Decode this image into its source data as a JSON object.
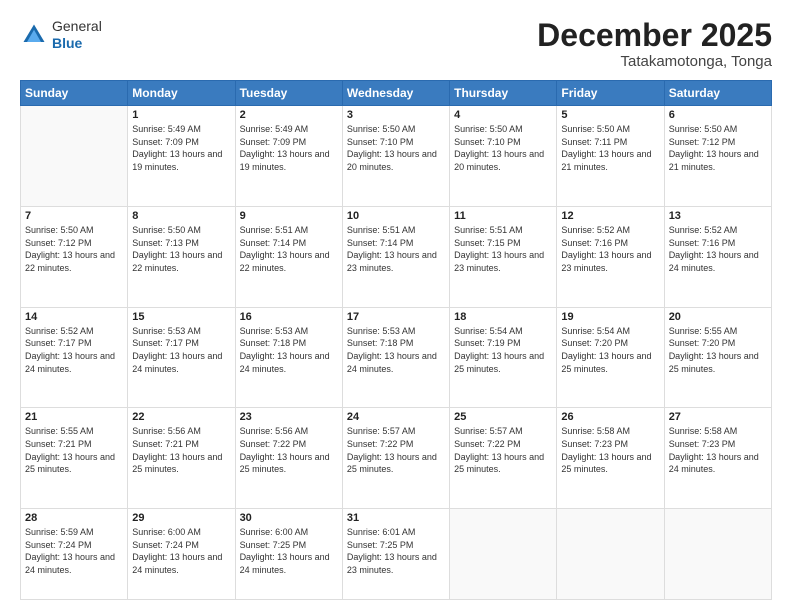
{
  "header": {
    "logo": {
      "general": "General",
      "blue": "Blue"
    },
    "title": "December 2025",
    "subtitle": "Tatakamotonga, Tonga"
  },
  "calendar": {
    "days_of_week": [
      "Sunday",
      "Monday",
      "Tuesday",
      "Wednesday",
      "Thursday",
      "Friday",
      "Saturday"
    ],
    "weeks": [
      [
        {
          "day": "",
          "sunrise": "",
          "sunset": "",
          "daylight": "",
          "empty": true
        },
        {
          "day": "1",
          "sunrise": "Sunrise: 5:49 AM",
          "sunset": "Sunset: 7:09 PM",
          "daylight": "Daylight: 13 hours and 19 minutes."
        },
        {
          "day": "2",
          "sunrise": "Sunrise: 5:49 AM",
          "sunset": "Sunset: 7:09 PM",
          "daylight": "Daylight: 13 hours and 19 minutes."
        },
        {
          "day": "3",
          "sunrise": "Sunrise: 5:50 AM",
          "sunset": "Sunset: 7:10 PM",
          "daylight": "Daylight: 13 hours and 20 minutes."
        },
        {
          "day": "4",
          "sunrise": "Sunrise: 5:50 AM",
          "sunset": "Sunset: 7:10 PM",
          "daylight": "Daylight: 13 hours and 20 minutes."
        },
        {
          "day": "5",
          "sunrise": "Sunrise: 5:50 AM",
          "sunset": "Sunset: 7:11 PM",
          "daylight": "Daylight: 13 hours and 21 minutes."
        },
        {
          "day": "6",
          "sunrise": "Sunrise: 5:50 AM",
          "sunset": "Sunset: 7:12 PM",
          "daylight": "Daylight: 13 hours and 21 minutes."
        }
      ],
      [
        {
          "day": "7",
          "sunrise": "Sunrise: 5:50 AM",
          "sunset": "Sunset: 7:12 PM",
          "daylight": "Daylight: 13 hours and 22 minutes."
        },
        {
          "day": "8",
          "sunrise": "Sunrise: 5:50 AM",
          "sunset": "Sunset: 7:13 PM",
          "daylight": "Daylight: 13 hours and 22 minutes."
        },
        {
          "day": "9",
          "sunrise": "Sunrise: 5:51 AM",
          "sunset": "Sunset: 7:14 PM",
          "daylight": "Daylight: 13 hours and 22 minutes."
        },
        {
          "day": "10",
          "sunrise": "Sunrise: 5:51 AM",
          "sunset": "Sunset: 7:14 PM",
          "daylight": "Daylight: 13 hours and 23 minutes."
        },
        {
          "day": "11",
          "sunrise": "Sunrise: 5:51 AM",
          "sunset": "Sunset: 7:15 PM",
          "daylight": "Daylight: 13 hours and 23 minutes."
        },
        {
          "day": "12",
          "sunrise": "Sunrise: 5:52 AM",
          "sunset": "Sunset: 7:16 PM",
          "daylight": "Daylight: 13 hours and 23 minutes."
        },
        {
          "day": "13",
          "sunrise": "Sunrise: 5:52 AM",
          "sunset": "Sunset: 7:16 PM",
          "daylight": "Daylight: 13 hours and 24 minutes."
        }
      ],
      [
        {
          "day": "14",
          "sunrise": "Sunrise: 5:52 AM",
          "sunset": "Sunset: 7:17 PM",
          "daylight": "Daylight: 13 hours and 24 minutes."
        },
        {
          "day": "15",
          "sunrise": "Sunrise: 5:53 AM",
          "sunset": "Sunset: 7:17 PM",
          "daylight": "Daylight: 13 hours and 24 minutes."
        },
        {
          "day": "16",
          "sunrise": "Sunrise: 5:53 AM",
          "sunset": "Sunset: 7:18 PM",
          "daylight": "Daylight: 13 hours and 24 minutes."
        },
        {
          "day": "17",
          "sunrise": "Sunrise: 5:53 AM",
          "sunset": "Sunset: 7:18 PM",
          "daylight": "Daylight: 13 hours and 24 minutes."
        },
        {
          "day": "18",
          "sunrise": "Sunrise: 5:54 AM",
          "sunset": "Sunset: 7:19 PM",
          "daylight": "Daylight: 13 hours and 25 minutes."
        },
        {
          "day": "19",
          "sunrise": "Sunrise: 5:54 AM",
          "sunset": "Sunset: 7:20 PM",
          "daylight": "Daylight: 13 hours and 25 minutes."
        },
        {
          "day": "20",
          "sunrise": "Sunrise: 5:55 AM",
          "sunset": "Sunset: 7:20 PM",
          "daylight": "Daylight: 13 hours and 25 minutes."
        }
      ],
      [
        {
          "day": "21",
          "sunrise": "Sunrise: 5:55 AM",
          "sunset": "Sunset: 7:21 PM",
          "daylight": "Daylight: 13 hours and 25 minutes."
        },
        {
          "day": "22",
          "sunrise": "Sunrise: 5:56 AM",
          "sunset": "Sunset: 7:21 PM",
          "daylight": "Daylight: 13 hours and 25 minutes."
        },
        {
          "day": "23",
          "sunrise": "Sunrise: 5:56 AM",
          "sunset": "Sunset: 7:22 PM",
          "daylight": "Daylight: 13 hours and 25 minutes."
        },
        {
          "day": "24",
          "sunrise": "Sunrise: 5:57 AM",
          "sunset": "Sunset: 7:22 PM",
          "daylight": "Daylight: 13 hours and 25 minutes."
        },
        {
          "day": "25",
          "sunrise": "Sunrise: 5:57 AM",
          "sunset": "Sunset: 7:22 PM",
          "daylight": "Daylight: 13 hours and 25 minutes."
        },
        {
          "day": "26",
          "sunrise": "Sunrise: 5:58 AM",
          "sunset": "Sunset: 7:23 PM",
          "daylight": "Daylight: 13 hours and 25 minutes."
        },
        {
          "day": "27",
          "sunrise": "Sunrise: 5:58 AM",
          "sunset": "Sunset: 7:23 PM",
          "daylight": "Daylight: 13 hours and 24 minutes."
        }
      ],
      [
        {
          "day": "28",
          "sunrise": "Sunrise: 5:59 AM",
          "sunset": "Sunset: 7:24 PM",
          "daylight": "Daylight: 13 hours and 24 minutes."
        },
        {
          "day": "29",
          "sunrise": "Sunrise: 6:00 AM",
          "sunset": "Sunset: 7:24 PM",
          "daylight": "Daylight: 13 hours and 24 minutes."
        },
        {
          "day": "30",
          "sunrise": "Sunrise: 6:00 AM",
          "sunset": "Sunset: 7:25 PM",
          "daylight": "Daylight: 13 hours and 24 minutes."
        },
        {
          "day": "31",
          "sunrise": "Sunrise: 6:01 AM",
          "sunset": "Sunset: 7:25 PM",
          "daylight": "Daylight: 13 hours and 23 minutes."
        },
        {
          "day": "",
          "sunrise": "",
          "sunset": "",
          "daylight": "",
          "empty": true
        },
        {
          "day": "",
          "sunrise": "",
          "sunset": "",
          "daylight": "",
          "empty": true
        },
        {
          "day": "",
          "sunrise": "",
          "sunset": "",
          "daylight": "",
          "empty": true
        }
      ]
    ]
  }
}
